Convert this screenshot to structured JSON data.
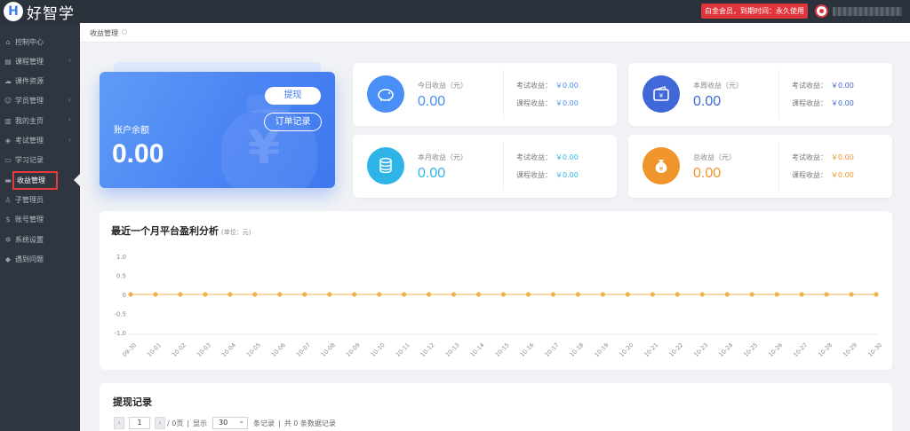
{
  "brand": {
    "logo_letter": "H",
    "name": "好智学"
  },
  "header": {
    "member_badge": "白金会员，到期时间：永久使用"
  },
  "sidebar": {
    "items": [
      {
        "label": "控制中心",
        "icon": "home-icon",
        "has_submenu": false
      },
      {
        "label": "课程管理",
        "icon": "book-icon",
        "has_submenu": true
      },
      {
        "label": "课件资源",
        "icon": "cloud-icon",
        "has_submenu": false
      },
      {
        "label": "学员管理",
        "icon": "users-icon",
        "has_submenu": true
      },
      {
        "label": "我的主页",
        "icon": "page-icon",
        "has_submenu": true
      },
      {
        "label": "考试管理",
        "icon": "tag-icon",
        "has_submenu": true
      },
      {
        "label": "学习记录",
        "icon": "record-icon",
        "has_submenu": false
      },
      {
        "label": "收益管理",
        "icon": "wallet-icon",
        "has_submenu": false,
        "active": true
      },
      {
        "label": "子管理员",
        "icon": "admin-icon",
        "has_submenu": false
      },
      {
        "label": "账号管理",
        "icon": "dollar-icon",
        "has_submenu": false
      },
      {
        "label": "系统设置",
        "icon": "gear-icon",
        "has_submenu": false
      },
      {
        "label": "遇到问题",
        "icon": "help-icon",
        "has_submenu": false
      }
    ]
  },
  "breadcrumb": {
    "current": "收益管理"
  },
  "balance": {
    "label": "账户余额",
    "value": "0.00",
    "withdraw_button": "提现",
    "orders_button": "订单记录"
  },
  "stats": [
    {
      "label": "今日收益（元）",
      "value": "0.00",
      "exam_label": "考试收益：",
      "exam_value": "￥0.00",
      "course_label": "课程收益：",
      "course_value": "￥0.00",
      "color": "#4a8ff7",
      "icon": "piggy-bank-icon"
    },
    {
      "label": "本周收益（元）",
      "value": "0.00",
      "exam_label": "考试收益：",
      "exam_value": "￥0.00",
      "course_label": "课程收益：",
      "course_value": "￥0.00",
      "color": "#4068d8",
      "icon": "wallet-icon"
    },
    {
      "label": "本月收益（元）",
      "value": "0.00",
      "exam_label": "考试收益：",
      "exam_value": "￥0.00",
      "course_label": "课程收益：",
      "course_value": "￥0.00",
      "color": "#2fb4e8",
      "icon": "coins-icon"
    },
    {
      "label": "总收益（元）",
      "value": "0.00",
      "exam_label": "考试收益：",
      "exam_value": "￥0.00",
      "course_label": "课程收益：",
      "course_value": "￥0.00",
      "color": "#f0952a",
      "icon": "money-bag-icon"
    }
  ],
  "chart_section": {
    "title": "最近一个月平台盈利分析",
    "unit": "(单位：元)"
  },
  "chart_data": {
    "type": "line",
    "x": [
      "09-30",
      "10-01",
      "10-02",
      "10-03",
      "10-04",
      "10-05",
      "10-06",
      "10-07",
      "10-08",
      "10-09",
      "10-10",
      "10-11",
      "10-12",
      "10-13",
      "10-14",
      "10-15",
      "10-16",
      "10-17",
      "10-18",
      "10-19",
      "10-20",
      "10-21",
      "10-22",
      "10-23",
      "10-24",
      "10-25",
      "10-26",
      "10-27",
      "10-28",
      "10-29",
      "10-30"
    ],
    "series": [
      {
        "values": [
          0,
          0,
          0,
          0,
          0,
          0,
          0,
          0,
          0,
          0,
          0,
          0,
          0,
          0,
          0,
          0,
          0,
          0,
          0,
          0,
          0,
          0,
          0,
          0,
          0,
          0,
          0,
          0,
          0,
          0,
          0
        ],
        "color": "#f0b24a"
      }
    ],
    "y_ticks": [
      "1.0",
      "0.5",
      "0",
      "-0.5",
      "-1.0"
    ],
    "ylim": [
      -1.0,
      1.0
    ],
    "grid": false
  },
  "records": {
    "title": "提现记录",
    "prev": "‹",
    "next": "›",
    "page": "1",
    "of_pages": "/ 0页",
    "show_label": "显示",
    "page_size": "30",
    "per_page_suffix": "条记录",
    "total_text": "共 0 条数据记录"
  }
}
